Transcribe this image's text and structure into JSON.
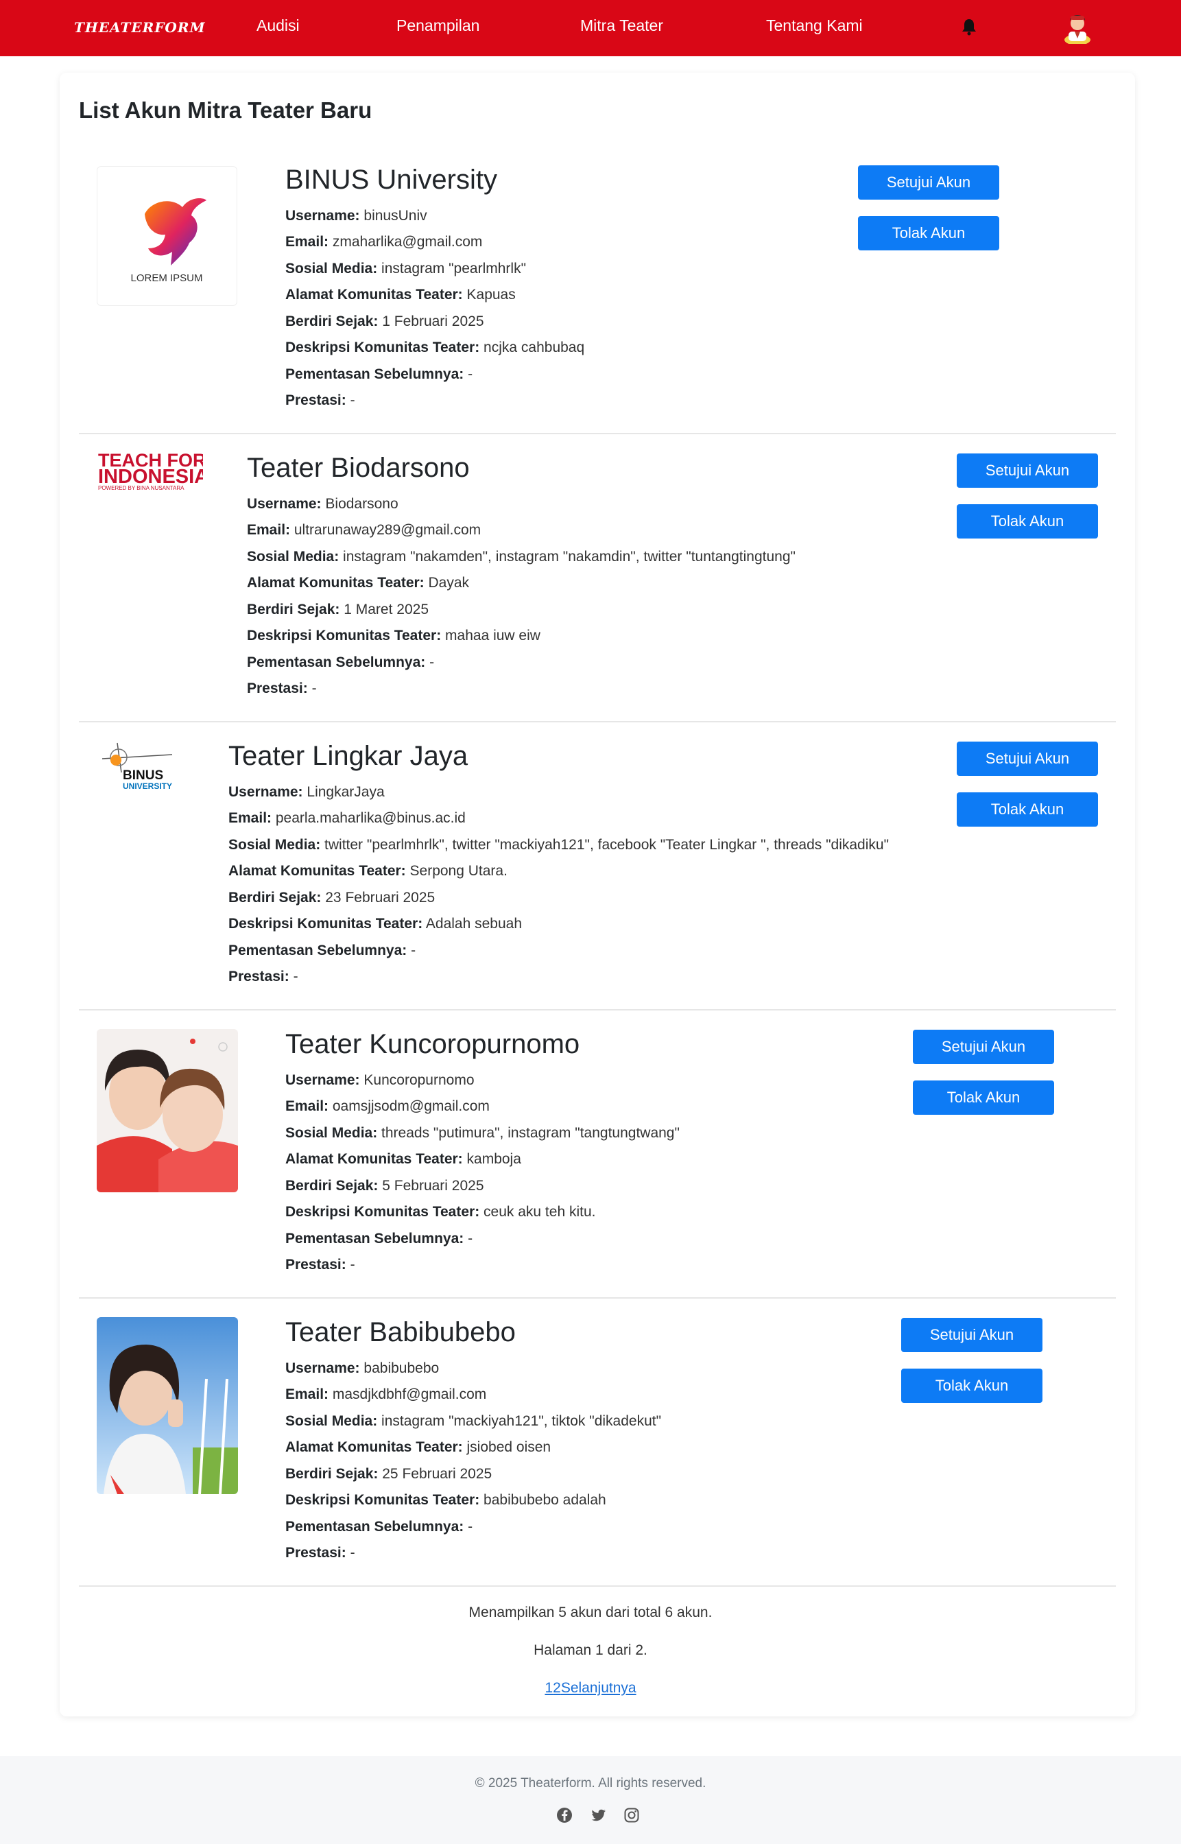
{
  "nav": {
    "brand": "THEATERFORM",
    "links": [
      "Audisi",
      "Penampilan",
      "Mitra Teater",
      "Tentang Kami"
    ]
  },
  "page": {
    "title": "List Akun Mitra Teater Baru"
  },
  "labels": {
    "username": "Username:",
    "email": "Email:",
    "sosmed": "Sosial Media:",
    "alamat": "Alamat Komunitas Teater:",
    "berdiri": "Berdiri Sejak:",
    "deskripsi": "Deskripsi Komunitas Teater:",
    "pementasan": "Pementasan Sebelumnya:",
    "prestasi": "Prestasi:",
    "approve": "Setujui Akun",
    "reject": "Tolak Akun"
  },
  "accounts": [
    {
      "name": "BINUS University",
      "username": "binusUniv",
      "email": "zmaharlika@gmail.com",
      "sosmed": "instagram \"pearlmhrlk\"",
      "alamat": "Kapuas",
      "berdiri": "1 Februari 2025",
      "deskripsi": "ncjka cahbubaq",
      "pementasan": "-",
      "prestasi": "-",
      "logo_text": "LOREM IPSUM"
    },
    {
      "name": "Teater Biodarsono",
      "username": "Biodarsono",
      "email": "ultrarunaway289@gmail.com",
      "sosmed": "instagram \"nakamden\", instagram \"nakamdin\", twitter \"tuntangtingtung\"",
      "alamat": "Dayak",
      "berdiri": "1 Maret 2025",
      "deskripsi": "mahaa iuw eiw",
      "pementasan": "-",
      "prestasi": "-",
      "logo_text": [
        "TEACH FOR",
        "INDONESIA",
        "POWERED BY BINA NUSANTARA"
      ]
    },
    {
      "name": "Teater Lingkar Jaya",
      "username": "LingkarJaya",
      "email": "pearla.maharlika@binus.ac.id",
      "sosmed": "twitter \"pearlmhrlk\", twitter \"mackiyah121\", facebook \"Teater Lingkar \", threads \"dikadiku\"",
      "alamat": "Serpong Utara.",
      "berdiri": "23 Februari 2025",
      "deskripsi": "Adalah sebuah",
      "pementasan": "-",
      "prestasi": "-",
      "logo_text": [
        "BINUS",
        "UNIVERSITY"
      ]
    },
    {
      "name": "Teater Kuncoropurnomo",
      "username": "Kuncoropurnomo",
      "email": "oamsjjsodm@gmail.com",
      "sosmed": "threads \"putimura\", instagram \"tangtungtwang\"",
      "alamat": "kamboja",
      "berdiri": "5 Februari 2025",
      "deskripsi": "ceuk aku teh kitu.",
      "pementasan": "-",
      "prestasi": "-"
    },
    {
      "name": "Teater Babibubebo",
      "username": "babibubebo",
      "email": "masdjkdbhf@gmail.com",
      "sosmed": "instagram \"mackiyah121\", tiktok \"dikadekut\"",
      "alamat": "jsiobed oisen",
      "berdiri": "25 Februari 2025",
      "deskripsi": "babibubebo adalah",
      "pementasan": "-",
      "prestasi": "-"
    }
  ],
  "summary": {
    "showing": "Menampilkan 5 akun dari total 6 akun.",
    "page": "Halaman 1 dari 2.",
    "pager": [
      "1",
      "2",
      "Selanjutnya"
    ]
  },
  "footer": {
    "copyright": "© 2025 Theaterform. All rights reserved."
  },
  "colors": {
    "nav": "#d90716",
    "button": "#0d7bf5",
    "link": "#1a6fd6"
  },
  "icons": [
    "bell-icon",
    "user-avatar",
    "facebook-icon",
    "twitter-icon",
    "instagram-icon"
  ]
}
